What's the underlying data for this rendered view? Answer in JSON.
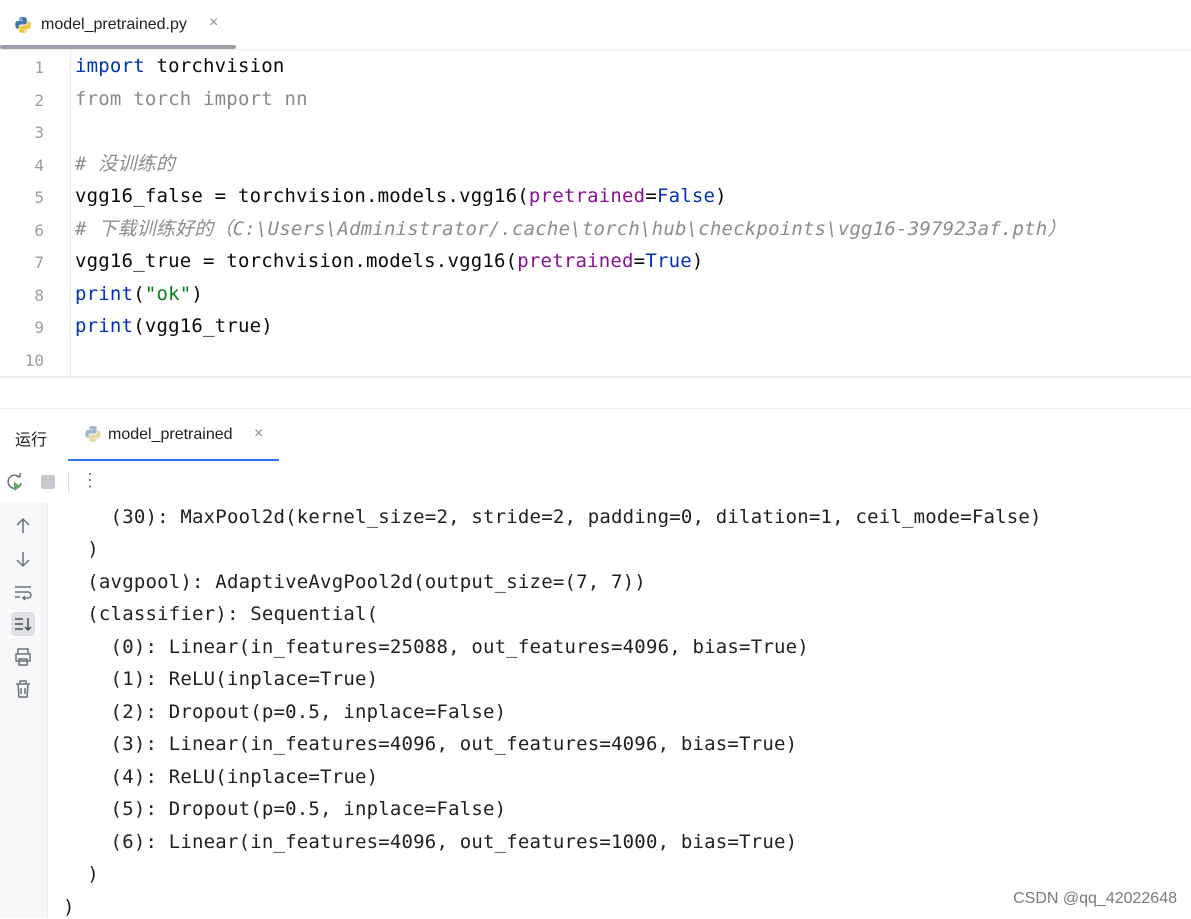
{
  "editor_tab": {
    "title": "model_pretrained.py",
    "close": "×"
  },
  "editor": {
    "line_numbers": [
      "1",
      "2",
      "3",
      "4",
      "5",
      "6",
      "7",
      "8",
      "9",
      "10"
    ],
    "lines": [
      {
        "segments": [
          {
            "t": "import",
            "c": "kw"
          },
          {
            "t": " torchvision",
            "c": ""
          }
        ]
      },
      {
        "segments": [
          {
            "t": "from torch import nn",
            "c": "dim"
          }
        ]
      },
      {
        "segments": []
      },
      {
        "segments": [
          {
            "t": "# 没训练的",
            "c": "cmt"
          }
        ]
      },
      {
        "segments": [
          {
            "t": "vgg16_false = torchvision.models.vgg16(",
            "c": ""
          },
          {
            "t": "pretrained",
            "c": "param"
          },
          {
            "t": "=",
            "c": ""
          },
          {
            "t": "False",
            "c": "kw"
          },
          {
            "t": ")",
            "c": ""
          }
        ]
      },
      {
        "segments": [
          {
            "t": "# 下载训练好的（C:\\Users\\Administrator/.cache\\torch\\hub\\checkpoints\\vgg16-397923af.pth）",
            "c": "cmt"
          }
        ]
      },
      {
        "segments": [
          {
            "t": "vgg16_true = torchvision.models.vgg16(",
            "c": ""
          },
          {
            "t": "pretrained",
            "c": "param"
          },
          {
            "t": "=",
            "c": ""
          },
          {
            "t": "True",
            "c": "kw"
          },
          {
            "t": ")",
            "c": ""
          }
        ]
      },
      {
        "segments": [
          {
            "t": "print",
            "c": "kw"
          },
          {
            "t": "(",
            "c": ""
          },
          {
            "t": "\"ok\"",
            "c": "str"
          },
          {
            "t": ")",
            "c": ""
          }
        ]
      },
      {
        "segments": [
          {
            "t": "print",
            "c": "kw"
          },
          {
            "t": "(vgg16_true)",
            "c": ""
          }
        ]
      },
      {
        "segments": []
      }
    ]
  },
  "run_panel": {
    "label": "运行",
    "tab_title": "model_pretrained",
    "tab_close": "×",
    "toolbar_more": "⋮"
  },
  "console": {
    "lines": [
      "    (30): MaxPool2d(kernel_size=2, stride=2, padding=0, dilation=1, ceil_mode=False)",
      "  )",
      "  (avgpool): AdaptiveAvgPool2d(output_size=(7, 7))",
      "  (classifier): Sequential(",
      "    (0): Linear(in_features=25088, out_features=4096, bias=True)",
      "    (1): ReLU(inplace=True)",
      "    (2): Dropout(p=0.5, inplace=False)",
      "    (3): Linear(in_features=4096, out_features=4096, bias=True)",
      "    (4): ReLU(inplace=True)",
      "    (5): Dropout(p=0.5, inplace=False)",
      "    (6): Linear(in_features=4096, out_features=1000, bias=True)",
      "  )",
      ")"
    ]
  },
  "watermark": "CSDN @qq_42022648",
  "colors": {
    "keyword": "#0033b3",
    "param": "#871094",
    "string": "#067d17",
    "comment": "#8c8c8c",
    "accent": "#3574f0"
  }
}
